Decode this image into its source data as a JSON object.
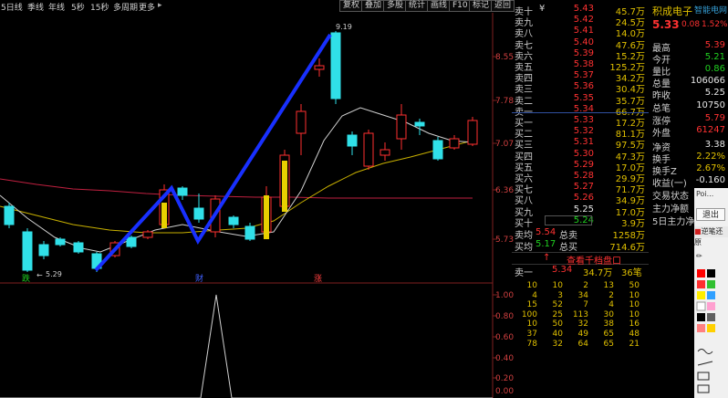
{
  "toolbar": {
    "items": [
      "5日线",
      "季线",
      "年线",
      "5秒",
      "15秒",
      "多周期",
      "更多"
    ],
    "more_arrow": "▸",
    "buttons": [
      "复权",
      "叠加",
      "多股",
      "统计",
      "画线",
      "F10",
      "标记",
      "返回"
    ]
  },
  "chart": {
    "price_labels": [
      "8.55",
      "7.78",
      "7.07",
      "6.36",
      "5.73"
    ],
    "osc_labels": [
      "1.00",
      "0.80",
      "0.60",
      "0.40",
      "0.20",
      "0.00"
    ],
    "high_label": "9.19",
    "low_label": "5.29",
    "markers": [
      "跌",
      "财",
      "涨"
    ],
    "colors": {
      "up": "#ff3030",
      "down": "#30e0e8",
      "ma_yellow": "#c8b000",
      "ma_white": "#d0d0d0",
      "ma_red": "#c02040",
      "trend": "#1830ff"
    }
  },
  "orderbook": {
    "asks": [
      {
        "label": "卖十",
        "px": "5.43",
        "vol": "45.7万",
        "pc": "red",
        "mark": "¥"
      },
      {
        "label": "卖九",
        "px": "5.42",
        "vol": "24.5万",
        "pc": "red"
      },
      {
        "label": "卖八",
        "px": "5.41",
        "vol": "14.0万",
        "pc": "red"
      },
      {
        "label": "卖七",
        "px": "5.40",
        "vol": "47.6万",
        "pc": "red"
      },
      {
        "label": "卖六",
        "px": "5.39",
        "vol": "15.2万",
        "pc": "red"
      },
      {
        "label": "卖五",
        "px": "5.38",
        "vol": "125.2万",
        "pc": "red"
      },
      {
        "label": "卖四",
        "px": "5.37",
        "vol": "34.2万",
        "pc": "red"
      },
      {
        "label": "卖三",
        "px": "5.36",
        "vol": "30.4万",
        "pc": "red"
      },
      {
        "label": "卖二",
        "px": "5.35",
        "vol": "35.7万",
        "pc": "red"
      },
      {
        "label": "卖一",
        "px": "5.34",
        "vol": "66.7万",
        "pc": "red"
      }
    ],
    "bids": [
      {
        "label": "买一",
        "px": "5.33",
        "vol": "17.2万",
        "pc": "red"
      },
      {
        "label": "买二",
        "px": "5.32",
        "vol": "81.1万",
        "pc": "red"
      },
      {
        "label": "买三",
        "px": "5.31",
        "vol": "97.5万",
        "pc": "red"
      },
      {
        "label": "买四",
        "px": "5.30",
        "vol": "47.3万",
        "pc": "red"
      },
      {
        "label": "买五",
        "px": "5.29",
        "vol": "17.0万",
        "pc": "red"
      },
      {
        "label": "买六",
        "px": "5.28",
        "vol": "29.9万",
        "pc": "red"
      },
      {
        "label": "买七",
        "px": "5.27",
        "vol": "71.7万",
        "pc": "red"
      },
      {
        "label": "买八",
        "px": "5.26",
        "vol": "34.9万",
        "pc": "red"
      },
      {
        "label": "买九",
        "px": "5.25",
        "vol": "17.0万",
        "pc": "wht"
      },
      {
        "label": "买十",
        "px": "5.24",
        "vol": "3.9万",
        "pc": "grn"
      }
    ],
    "avg_ask": {
      "label": "卖均",
      "px": "5.54",
      "tot_label": "总卖",
      "tot": "1258万"
    },
    "avg_bid": {
      "label": "买均",
      "px": "5.17",
      "tot_label": "总买",
      "tot": "714.6万"
    },
    "queue_button": "查看千档盘口",
    "queue_arrow": "↑",
    "queue_head": {
      "label": "卖一",
      "px": "5.34",
      "vol": "34.7万",
      "unit": "笔",
      "count": "36笔"
    },
    "queue_rows": [
      [
        "10",
        "10",
        "2",
        "13",
        "50"
      ],
      [
        "4",
        "3",
        "34",
        "2",
        "10"
      ],
      [
        "15",
        "52",
        "7",
        "4",
        "10"
      ],
      [
        "100",
        "25",
        "113",
        "30",
        "10"
      ],
      [
        "10",
        "50",
        "32",
        "38",
        "16"
      ],
      [
        "37",
        "40",
        "49",
        "65",
        "48"
      ],
      [
        "78",
        "32",
        "64",
        "65",
        "21"
      ]
    ]
  },
  "info": {
    "name": "积成电子",
    "tag": "智能电网",
    "price": "5.33",
    "change": "0.08",
    "pct": "1.52%",
    "rows": [
      {
        "l": "最高",
        "v": "5.39",
        "c": "red"
      },
      {
        "l": "今开",
        "v": "5.21",
        "c": "grn"
      },
      {
        "l": "量比",
        "v": "0.86",
        "c": "grn"
      },
      {
        "l": "总量",
        "v": "106066",
        "c": "wht"
      },
      {
        "l": "昨收",
        "v": "5.25",
        "c": "wht"
      },
      {
        "l": "总笔",
        "v": "10750",
        "c": "wht"
      },
      {
        "l": "涨停",
        "v": "5.79",
        "c": "red"
      },
      {
        "l": "外盘",
        "v": "61247",
        "c": "red"
      },
      {
        "l": "净资",
        "v": "3.38",
        "c": "wht"
      },
      {
        "l": "换手",
        "v": "2.22%",
        "c": "yel"
      },
      {
        "l": "换手Z",
        "v": "2.67%",
        "c": "yel"
      },
      {
        "l": "收益(一)",
        "v": "-0.160",
        "c": "wht"
      },
      {
        "l": "交易状态",
        "v": "",
        "c": "wht"
      },
      {
        "l": "主力净额",
        "v": "",
        "c": "wht"
      },
      {
        "l": "5日主力净",
        "v": "",
        "c": "wht"
      }
    ],
    "popup_top": "Poi...",
    "popup_exit": "退出",
    "popup_back": "逆笔还原"
  }
}
